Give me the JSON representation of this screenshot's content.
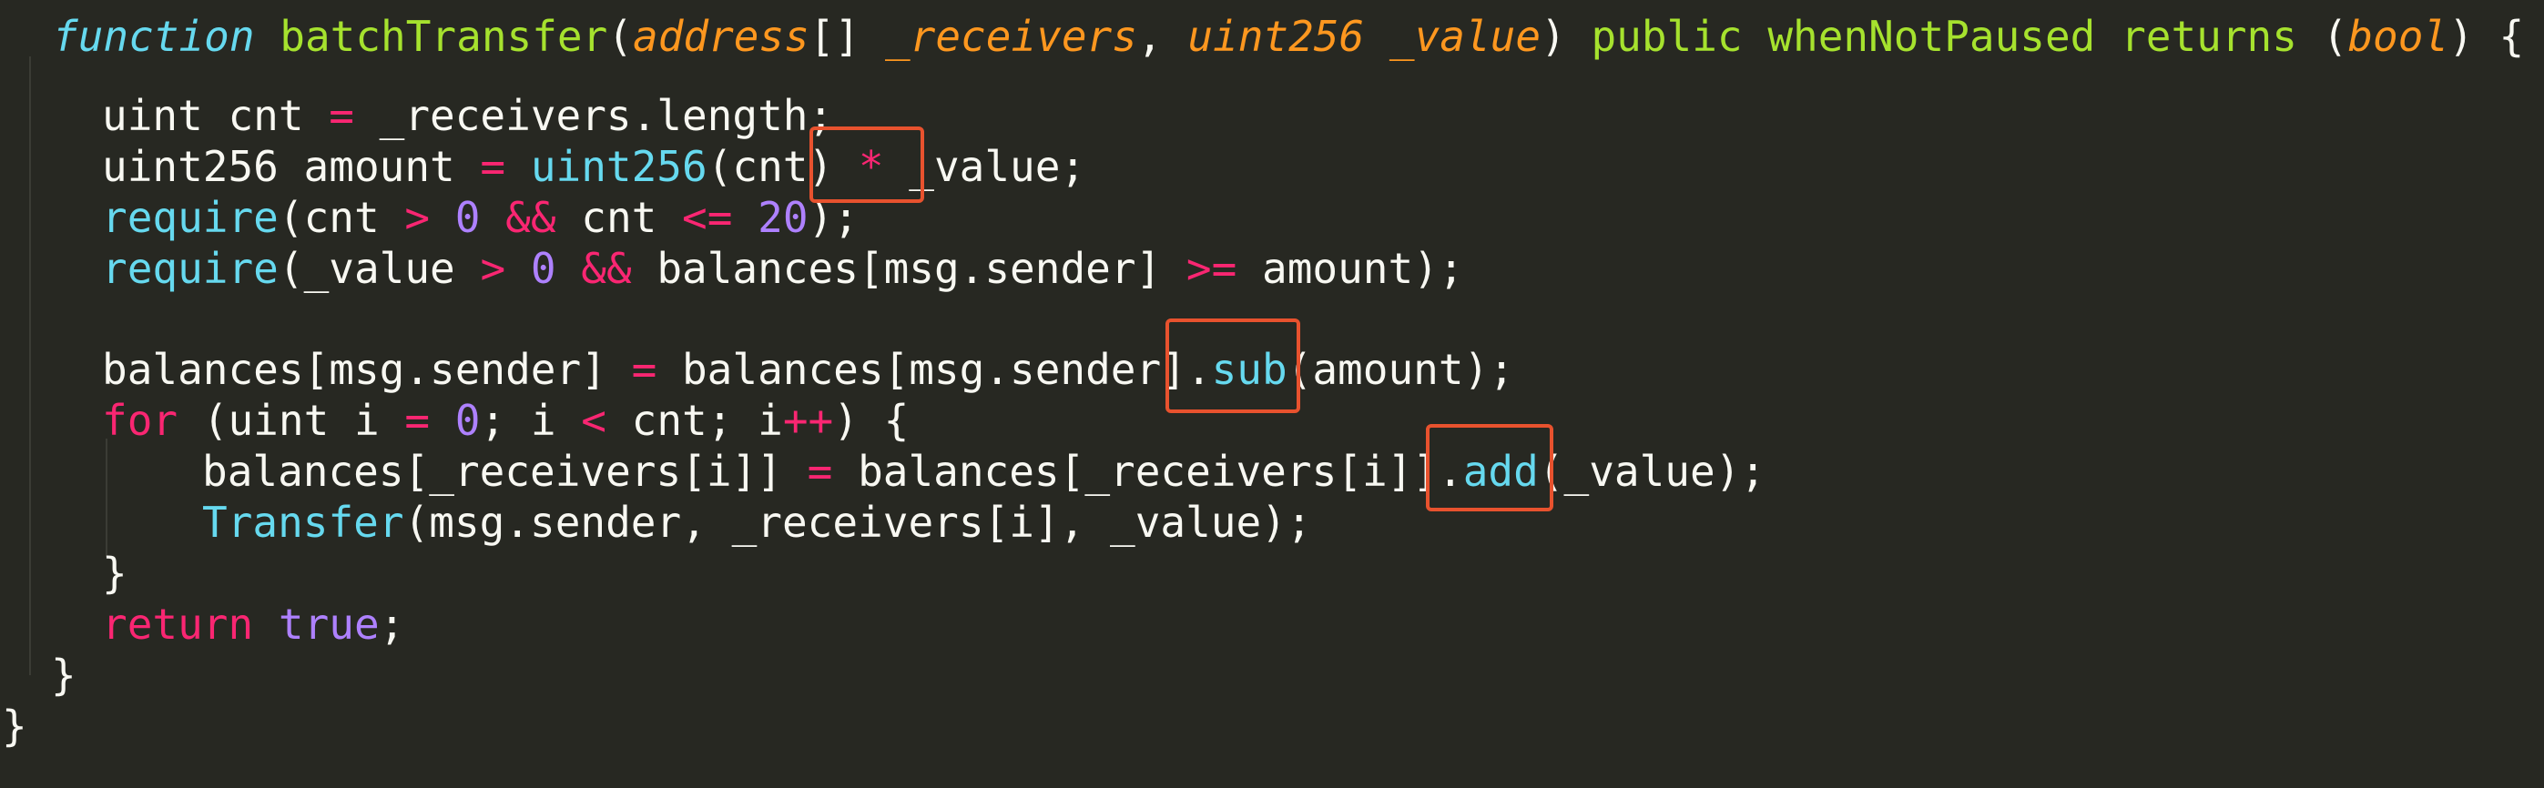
{
  "theme": {
    "background": "#272822",
    "highlight_border": "#e8522e",
    "token_colors": {
      "plain": "#f8f8f2",
      "keyword": "#f92672",
      "storage": "#66d9ef",
      "function": "#a6e22e",
      "param": "#fd971f",
      "constant": "#ae81ff"
    }
  },
  "code": {
    "lines": [
      [
        {
          "t": "function",
          "c": "storage",
          "i": true
        },
        {
          "t": " ",
          "c": "plain"
        },
        {
          "t": "batchTransfer",
          "c": "function"
        },
        {
          "t": "(",
          "c": "plain"
        },
        {
          "t": "address",
          "c": "param",
          "i": true
        },
        {
          "t": "[] ",
          "c": "plain"
        },
        {
          "t": "_receivers",
          "c": "param",
          "i": true
        },
        {
          "t": ", ",
          "c": "plain"
        },
        {
          "t": "uint256",
          "c": "param",
          "i": true
        },
        {
          "t": " ",
          "c": "plain"
        },
        {
          "t": "_value",
          "c": "param",
          "i": true
        },
        {
          "t": ") ",
          "c": "plain"
        },
        {
          "t": "public",
          "c": "function"
        },
        {
          "t": " ",
          "c": "plain"
        },
        {
          "t": "whenNotPaused",
          "c": "function"
        },
        {
          "t": " ",
          "c": "plain"
        },
        {
          "t": "returns",
          "c": "function"
        },
        {
          "t": " (",
          "c": "plain"
        },
        {
          "t": "bool",
          "c": "param",
          "i": true
        },
        {
          "t": ") {",
          "c": "plain"
        }
      ],
      [
        {
          "t": "uint cnt ",
          "c": "plain"
        },
        {
          "t": "=",
          "c": "keyword"
        },
        {
          "t": " _receivers.length;",
          "c": "plain"
        }
      ],
      [
        {
          "t": "uint256 amount ",
          "c": "plain"
        },
        {
          "t": "=",
          "c": "keyword"
        },
        {
          "t": " ",
          "c": "plain"
        },
        {
          "t": "uint256",
          "c": "storage"
        },
        {
          "t": "(cnt) ",
          "c": "plain"
        },
        {
          "t": "*",
          "c": "keyword"
        },
        {
          "t": " _value;",
          "c": "plain"
        }
      ],
      [
        {
          "t": "require",
          "c": "storage"
        },
        {
          "t": "(cnt ",
          "c": "plain"
        },
        {
          "t": ">",
          "c": "keyword"
        },
        {
          "t": " ",
          "c": "plain"
        },
        {
          "t": "0",
          "c": "constant"
        },
        {
          "t": " ",
          "c": "plain"
        },
        {
          "t": "&&",
          "c": "keyword"
        },
        {
          "t": " cnt ",
          "c": "plain"
        },
        {
          "t": "<=",
          "c": "keyword"
        },
        {
          "t": " ",
          "c": "plain"
        },
        {
          "t": "20",
          "c": "constant"
        },
        {
          "t": ");",
          "c": "plain"
        }
      ],
      [
        {
          "t": "require",
          "c": "storage"
        },
        {
          "t": "(_value ",
          "c": "plain"
        },
        {
          "t": ">",
          "c": "keyword"
        },
        {
          "t": " ",
          "c": "plain"
        },
        {
          "t": "0",
          "c": "constant"
        },
        {
          "t": " ",
          "c": "plain"
        },
        {
          "t": "&&",
          "c": "keyword"
        },
        {
          "t": " balances[msg.sender] ",
          "c": "plain"
        },
        {
          "t": ">=",
          "c": "keyword"
        },
        {
          "t": " amount);",
          "c": "plain"
        }
      ],
      [],
      [
        {
          "t": "balances[msg.sender] ",
          "c": "plain"
        },
        {
          "t": "=",
          "c": "keyword"
        },
        {
          "t": " balances[msg.sender].",
          "c": "plain"
        },
        {
          "t": "sub",
          "c": "storage"
        },
        {
          "t": "(amount);",
          "c": "plain"
        }
      ],
      [
        {
          "t": "for",
          "c": "keyword"
        },
        {
          "t": " (uint i ",
          "c": "plain"
        },
        {
          "t": "=",
          "c": "keyword"
        },
        {
          "t": " ",
          "c": "plain"
        },
        {
          "t": "0",
          "c": "constant"
        },
        {
          "t": "; i ",
          "c": "plain"
        },
        {
          "t": "<",
          "c": "keyword"
        },
        {
          "t": " cnt; i",
          "c": "plain"
        },
        {
          "t": "++",
          "c": "keyword"
        },
        {
          "t": ") {",
          "c": "plain"
        }
      ],
      [
        {
          "t": "balances[_receivers[i]] ",
          "c": "plain"
        },
        {
          "t": "=",
          "c": "keyword"
        },
        {
          "t": " balances[_receivers[i]].",
          "c": "plain"
        },
        {
          "t": "add",
          "c": "storage"
        },
        {
          "t": "(_value);",
          "c": "plain"
        }
      ],
      [
        {
          "t": "Transfer",
          "c": "storage"
        },
        {
          "t": "(msg.sender, _receivers[i], _value);",
          "c": "plain"
        }
      ],
      [
        {
          "t": "}",
          "c": "plain"
        }
      ],
      [
        {
          "t": "return",
          "c": "keyword"
        },
        {
          "t": " ",
          "c": "plain"
        },
        {
          "t": "true",
          "c": "constant"
        },
        {
          "t": ";",
          "c": "plain"
        }
      ],
      [
        {
          "t": "}",
          "c": "plain"
        }
      ],
      [
        {
          "t": "}",
          "c": "plain"
        }
      ]
    ]
  }
}
